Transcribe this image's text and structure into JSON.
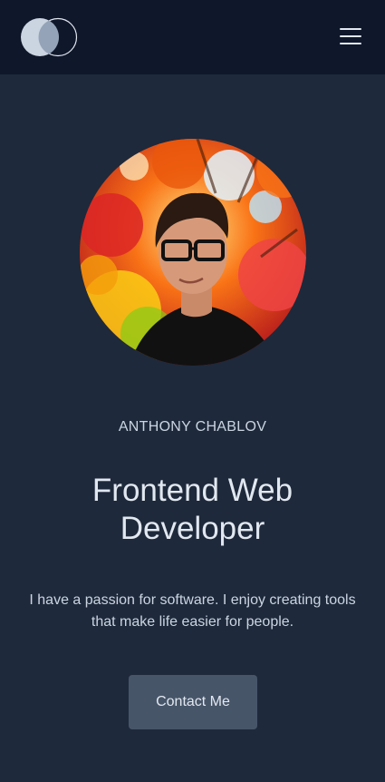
{
  "nav": {
    "logo_icon": "two-overlapping-circles-logo",
    "menu_icon": "hamburger-menu-icon"
  },
  "hero": {
    "avatar_alt": "profile-photo",
    "name": "ANTHONY CHABLOV",
    "role": "Frontend Web Developer",
    "bio": "I have a passion for software. I enjoy creating tools that make life easier for people.",
    "contact_label": "Contact Me"
  },
  "colors": {
    "nav_bg": "#0f172a",
    "page_bg": "#1e293b",
    "button_bg": "#475569",
    "text": "#e2e8f0"
  }
}
